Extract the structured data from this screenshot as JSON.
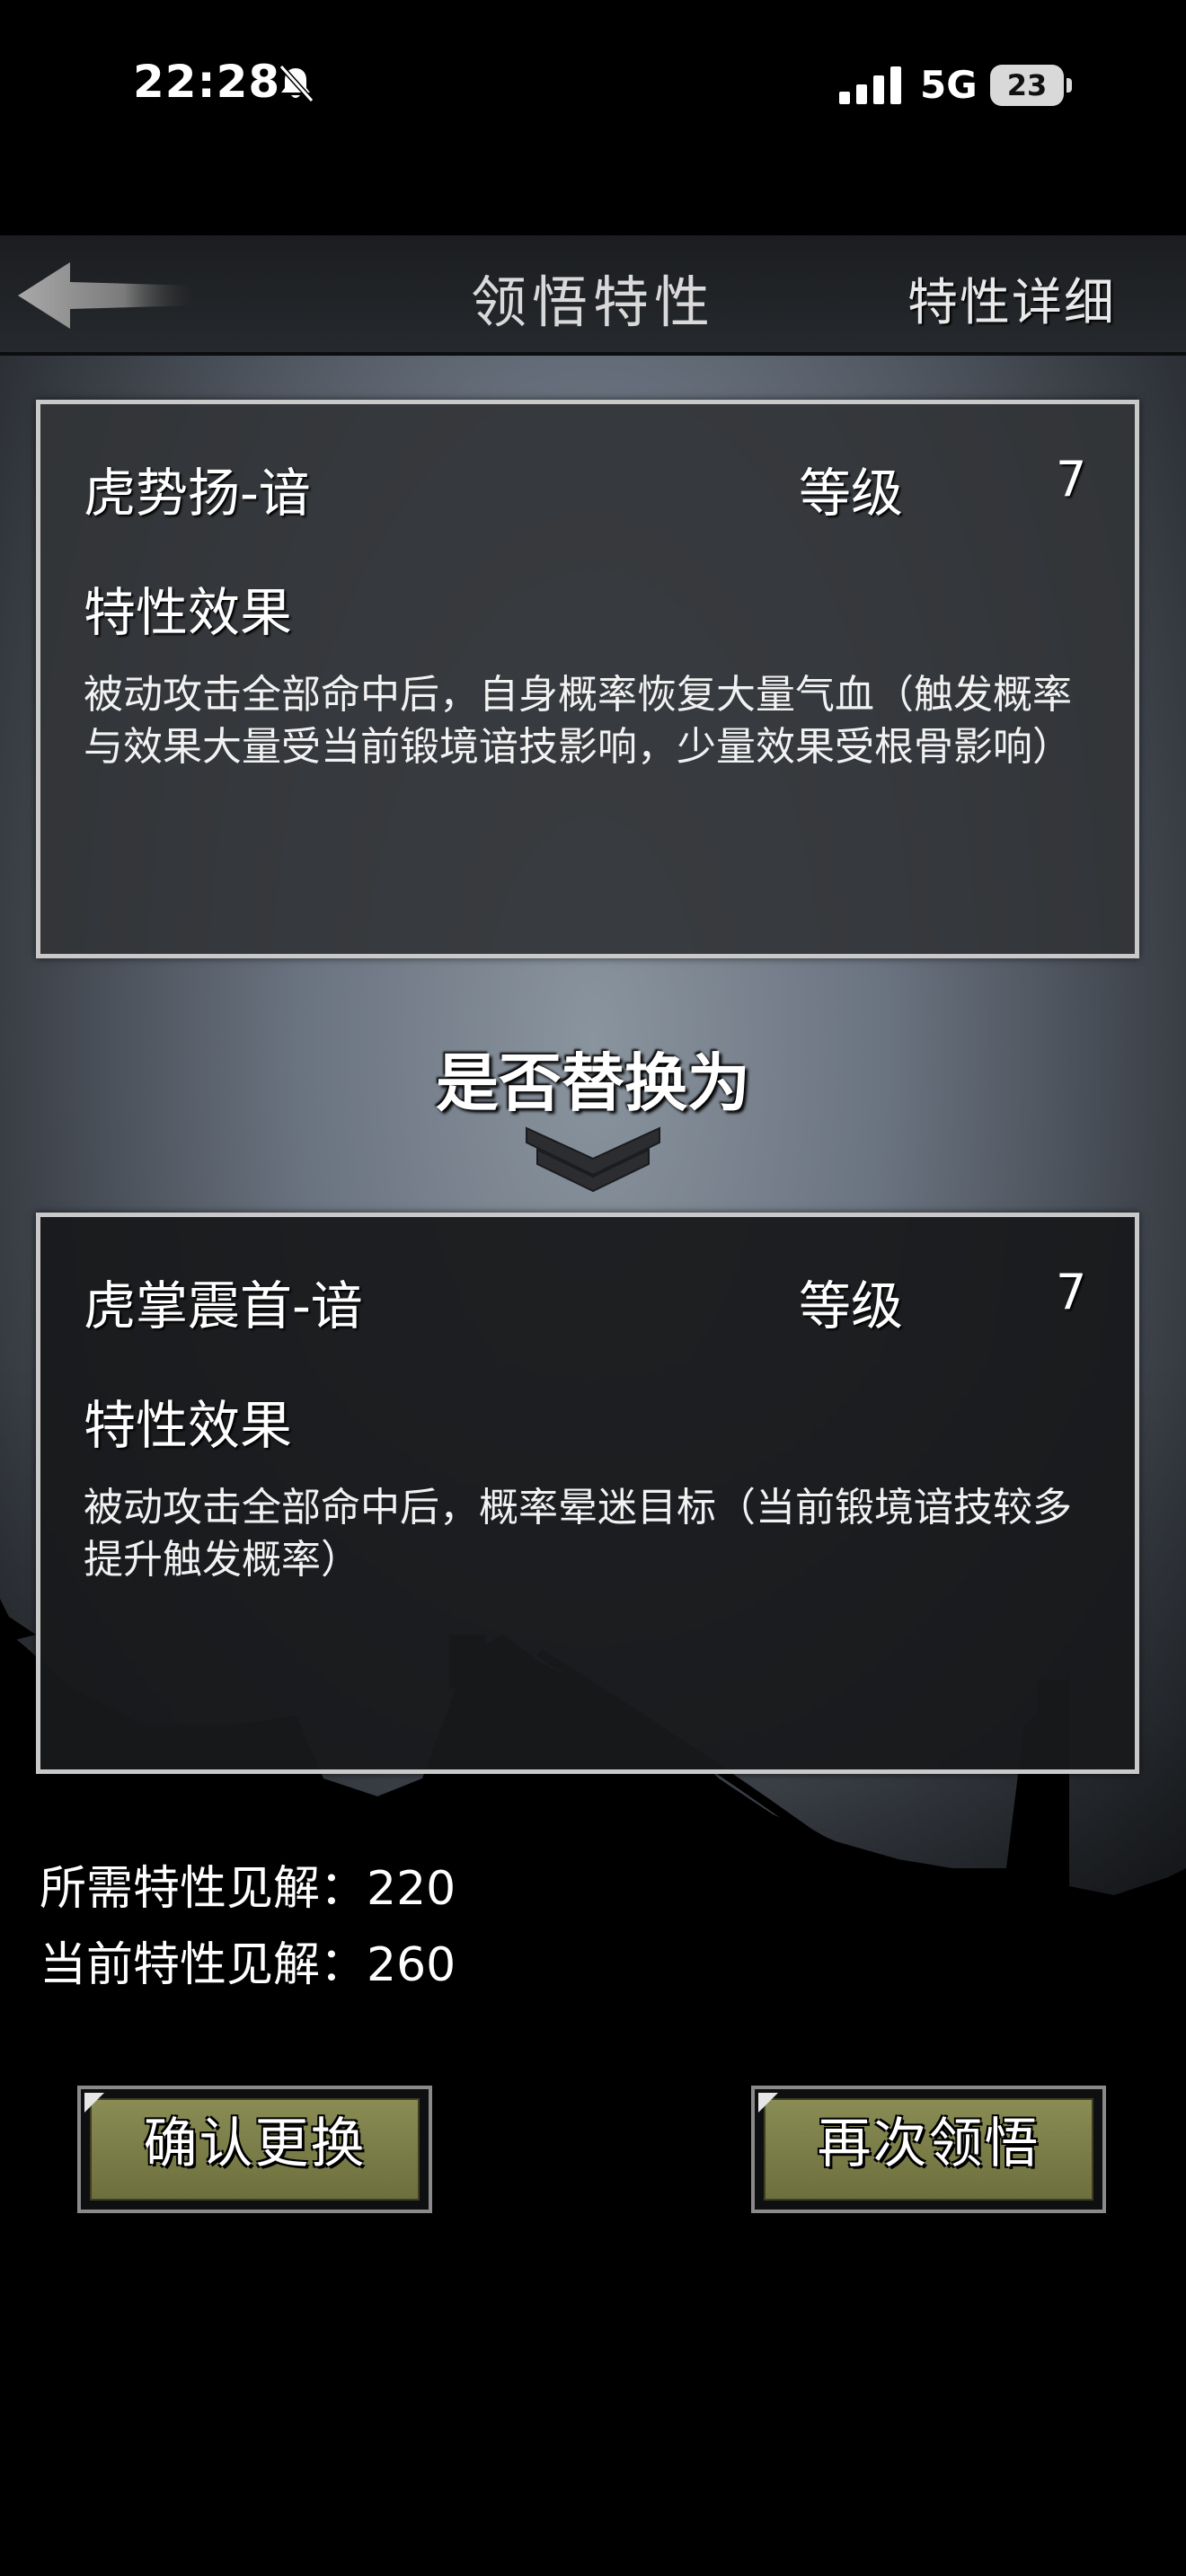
{
  "status_bar": {
    "time": "22:28",
    "network": "5G",
    "battery": "23"
  },
  "header": {
    "title": "领悟特性",
    "detail_button": "特性详细"
  },
  "current_trait": {
    "name": "虎势扬-谙",
    "level_label": "等级",
    "level": "7",
    "effect_title": "特性效果",
    "effect_text": "被动攻击全部命中后，自身概率恢复大量气血（触发概率与效果大量受当前锻境谙技影响，少量效果受根骨影响）"
  },
  "replace_prompt": "是否替换为",
  "new_trait": {
    "name": "虎掌震首-谙",
    "level_label": "等级",
    "level": "7",
    "effect_title": "特性效果",
    "effect_text": "被动攻击全部命中后，概率晕迷目标（当前锻境谙技较多提升触发概率）"
  },
  "insight": {
    "required": "所需特性见解：220",
    "current": "当前特性见解：260"
  },
  "buttons": {
    "confirm": "确认更换",
    "again": "再次领悟"
  }
}
